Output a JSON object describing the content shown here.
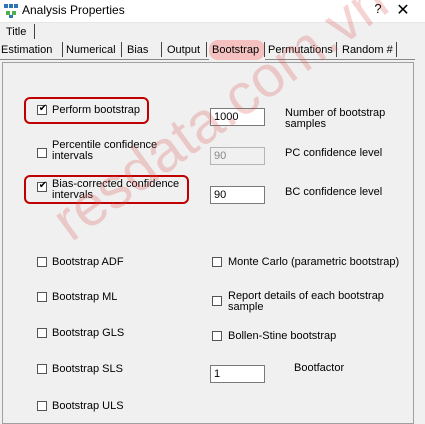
{
  "window": {
    "title": "Analysis Properties",
    "help_glyph": "?",
    "close_glyph": "✕"
  },
  "tabs_row1": [
    {
      "label": "Title"
    }
  ],
  "tabs_row2": [
    {
      "label": "Estimation"
    },
    {
      "label": "Numerical"
    },
    {
      "label": "Bias"
    },
    {
      "label": "Output"
    },
    {
      "label": "Bootstrap",
      "selected": true
    },
    {
      "label": "Permutations"
    },
    {
      "label": "Random #"
    }
  ],
  "bootstrap": {
    "perform_bootstrap": {
      "label": "Perform bootstrap",
      "checked": true
    },
    "num_samples": {
      "value": "1000",
      "label": "Number of bootstrap\nsamples"
    },
    "percentile_ci": {
      "label": "Percentile confidence\nintervals",
      "checked": false
    },
    "pc_level": {
      "value": "90",
      "label": "PC confidence level"
    },
    "bias_corrected_ci": {
      "label": "Bias-corrected confidence\nintervals",
      "checked": true
    },
    "bc_level": {
      "value": "90",
      "label": "BC confidence level"
    },
    "bootstrap_adf": {
      "label": "Bootstrap ADF",
      "checked": false
    },
    "monte_carlo": {
      "label": "Monte Carlo (parametric bootstrap)",
      "checked": false
    },
    "bootstrap_ml": {
      "label": "Bootstrap ML",
      "checked": false
    },
    "report_details": {
      "label": "Report details of each bootstrap\nsample",
      "checked": false
    },
    "bootstrap_gls": {
      "label": "Bootstrap GLS",
      "checked": false
    },
    "bollen_stine": {
      "label": "Bollen-Stine bootstrap",
      "checked": false
    },
    "bootstrap_sls": {
      "label": "Bootstrap SLS",
      "checked": false
    },
    "bootfactor": {
      "value": "1",
      "label": "Bootfactor"
    },
    "bootstrap_uls": {
      "label": "Bootstrap ULS",
      "checked": false
    }
  },
  "watermark": "resdata.com.vn",
  "colors": {
    "highlight": "#c00000",
    "selected_tab": "#f4c0c0"
  }
}
